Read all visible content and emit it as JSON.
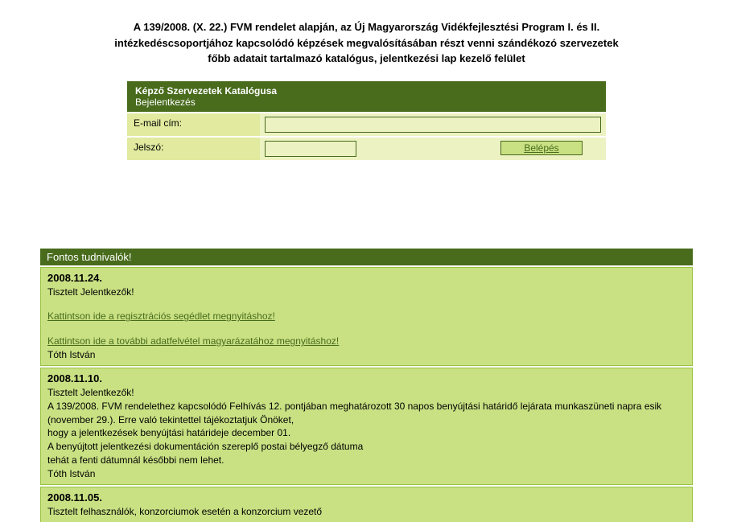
{
  "header": {
    "line1": "A 139/2008. (X. 22.) FVM rendelet alapján, az Új Magyarország Vidékfejlesztési Program I. és II.",
    "line2": "intézkedéscsoportjához kapcsolódó képzések megvalósításában részt venni szándékozó szervezetek",
    "line3": "főbb adatait tartalmazó katalógus, jelentkezési lap kezelő felület"
  },
  "login": {
    "title": "Képző Szervezetek Katalógusa",
    "subtitle": "Bejelentkezés",
    "email_label": "E-mail cím:",
    "password_label": "Jelszó:",
    "button": "Belépés",
    "email_value": "",
    "password_value": ""
  },
  "news": {
    "header": "Fontos tudnivalók!",
    "items": [
      {
        "date": "2008.11.24.",
        "greeting": "Tisztelt Jelentkezők!",
        "link1": "Kattintson ide a regisztrációs segédlet megnyitáshoz!",
        "link2": "Kattintson ide a további adatfelvétel magyarázatához megnyitáshoz!",
        "author": "Tóth István"
      },
      {
        "date": "2008.11.10.",
        "greeting": "Tisztelt Jelentkezők!",
        "body1": "A 139/2008. FVM rendelethez kapcsolódó Felhívás 12. pontjában meghatározott 30 napos benyújtási határidő lejárata munkaszüneti napra esik (november 29.). Erre való tekintettel tájékoztatjuk Önöket,",
        "body2": "hogy a jelentkezések benyújtási határideje december 01.",
        "body3": "A benyújtott jelentkezési dokumentáción szereplő postai bélyegző dátuma",
        "body4": "tehát a fenti dátumnál későbbi nem lehet.",
        "author": "Tóth István"
      },
      {
        "date": "2008.11.05.",
        "greeting": "Tisztelt felhasználók, konzorciumok esetén a konzorcium vezető"
      }
    ]
  }
}
